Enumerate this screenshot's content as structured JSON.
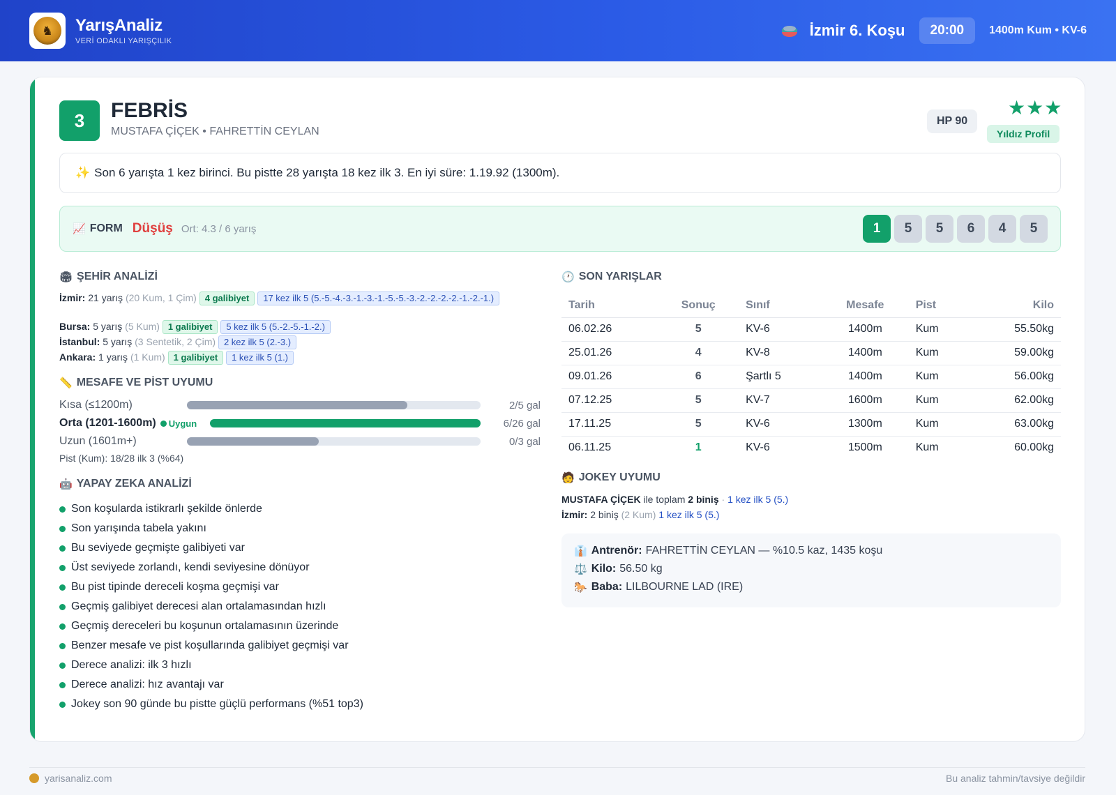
{
  "header": {
    "brand_title": "YarışAnaliz",
    "brand_subtitle": "VERİ ODAKLI YARIŞÇILIK",
    "race_title": "İzmir 6. Koşu",
    "race_time": "20:00",
    "race_meta": "1400m Kum • KV-6"
  },
  "horse": {
    "number": "3",
    "name": "FEBRİS",
    "subtitle": "MUSTAFA ÇİÇEK • FAHRETTİN CEYLAN",
    "hp": "HP 90",
    "stars": "★★★",
    "star_count": 3,
    "profile_badge": "Yıldız Profil"
  },
  "summary": "Son 6 yarışta 1 kez birinci. Bu pistte 28 yarışta 18 kez ilk 3. En iyi süre: 1.19.92 (1300m).",
  "form": {
    "label": "FORM",
    "trend": "Düşüş",
    "average": "Ort: 4.3 / 6 yarış",
    "results": [
      "1",
      "5",
      "5",
      "6",
      "4",
      "5"
    ]
  },
  "city_analysis": {
    "title": "ŞEHİR ANALİZİ",
    "rows": [
      {
        "city": "İzmir:",
        "races": "21 yarış",
        "detail": "(20 Kum, 1 Çim)",
        "wins": "4 galibiyet",
        "top5": "17 kez ilk 5 (5.-5.-4.-3.-1.-3.-1.-5.-5.-3.-2.-2.-2.-2.-1.-2.-1.)"
      },
      {
        "city": "Bursa:",
        "races": "5 yarış",
        "detail": "(5 Kum)",
        "wins": "1 galibiyet",
        "top5": "5 kez ilk 5 (5.-2.-5.-1.-2.)"
      },
      {
        "city": "İstanbul:",
        "races": "5 yarış",
        "detail": "(3 Sentetik, 2 Çim)",
        "wins": "",
        "top5": "2 kez ilk 5 (2.-3.)"
      },
      {
        "city": "Ankara:",
        "races": "1 yarış",
        "detail": "(1 Kum)",
        "wins": "1 galibiyet",
        "top5": "1 kez ilk 5 (1.)"
      }
    ]
  },
  "distance": {
    "title": "MESAFE VE PİST UYUMU",
    "rows": [
      {
        "label": "Kısa (≤1200m)",
        "value": "2/5 gal",
        "fill": 0.75,
        "active": false,
        "badge": ""
      },
      {
        "label": "Orta (1201-1600m)",
        "value": "6/26 gal",
        "fill": 1.0,
        "active": true,
        "badge": "Uygun"
      },
      {
        "label": "Uzun (1601m+)",
        "value": "0/3 gal",
        "fill": 0.45,
        "active": false,
        "badge": ""
      }
    ],
    "pist": "Pist (Kum): 18/28 ilk 3 (%64)"
  },
  "ai": {
    "title": "YAPAY ZEKA ANALİZİ",
    "items": [
      "Son koşularda istikrarlı şekilde önlerde",
      "Son yarışında tabela yakını",
      "Bu seviyede geçmişte galibiyeti var",
      "Üst seviyede zorlandı, kendi seviyesine dönüyor",
      "Bu pist tipinde dereceli koşma geçmişi var",
      "Geçmiş galibiyet derecesi alan ortalamasından hızlı",
      "Geçmiş dereceleri bu koşunun ortalamasının üzerinde",
      "Benzer mesafe ve pist koşullarında galibiyet geçmişi var",
      "Derece analizi: ilk 3 hızlı",
      "Derece analizi: hız avantajı var",
      "Jokey son 90 günde bu pistte güçlü performans (%51 top3)"
    ]
  },
  "races": {
    "title": "SON YARIŞLAR",
    "columns": [
      "Tarih",
      "Sonuç",
      "Sınıf",
      "Mesafe",
      "Pist",
      "Kilo"
    ],
    "rows": [
      [
        "06.02.26",
        "5",
        "KV-6",
        "1400m",
        "Kum",
        "55.50kg"
      ],
      [
        "25.01.26",
        "4",
        "KV-8",
        "1400m",
        "Kum",
        "59.00kg"
      ],
      [
        "09.01.26",
        "6",
        "Şartlı 5",
        "1400m",
        "Kum",
        "56.00kg"
      ],
      [
        "07.12.25",
        "5",
        "KV-7",
        "1600m",
        "Kum",
        "62.00kg"
      ],
      [
        "17.11.25",
        "5",
        "KV-6",
        "1300m",
        "Kum",
        "63.00kg"
      ],
      [
        "06.11.25",
        "1",
        "KV-6",
        "1500m",
        "Kum",
        "60.00kg"
      ]
    ]
  },
  "jokey": {
    "title": "JOKEY UYUMU",
    "name": "MUSTAFA ÇİÇEK",
    "text1": "ile toplam",
    "total": "2 biniş",
    "sep": "·",
    "top5": "1 kez ilk 5 (5.)",
    "city": "İzmir:",
    "city_rides": "2 biniş",
    "city_detail": "(2 Kum)",
    "city_top5": "1 kez ilk 5 (5.)"
  },
  "info": {
    "trainer_label": "Antrenör:",
    "trainer_value": "FAHRETTİN CEYLAN — %10.5 kaz, 1435 koşu",
    "weight_label": "Kilo:",
    "weight_value": "56.50 kg",
    "sire_label": "Baba:",
    "sire_value": "LILBOURNE LAD (IRE)"
  },
  "footer": {
    "site": "yarisanaliz.com",
    "disclaimer": "Bu analiz tahmin/tavsiye değildir"
  }
}
